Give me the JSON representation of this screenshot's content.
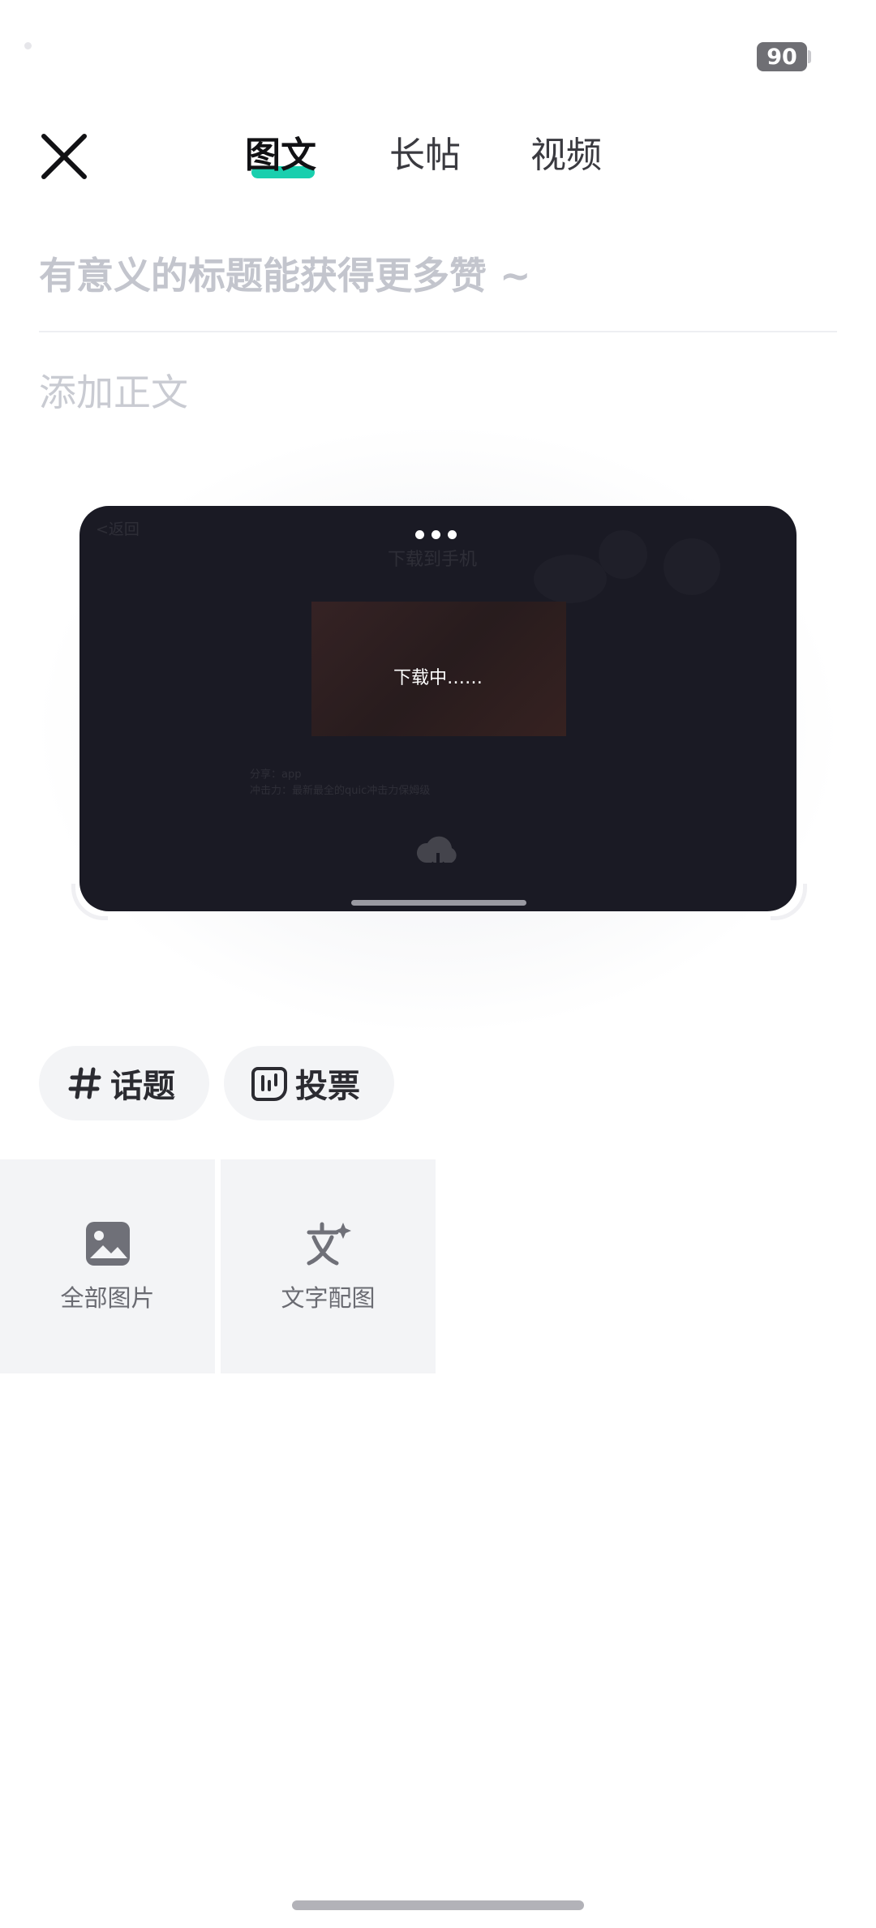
{
  "status_bar": {
    "battery": "90"
  },
  "header": {
    "tabs": [
      {
        "label": "图文",
        "active": true
      },
      {
        "label": "长帖",
        "active": false
      },
      {
        "label": "视频",
        "active": false
      }
    ],
    "accent_color": "#19cfae"
  },
  "editor": {
    "title_placeholder": "有意义的标题能获得更多赞 ~",
    "body_placeholder": "添加正文"
  },
  "video_preview": {
    "status_text": "下载中……",
    "background_texts": [
      "<返回",
      "下载到手机",
      "分享：app",
      "冲击力：最新最全的quic冲击力保姆级"
    ]
  },
  "chips": [
    {
      "icon": "hashtag-icon",
      "label": "话题"
    },
    {
      "icon": "poll-icon",
      "label": "投票"
    }
  ],
  "media_tiles": [
    {
      "icon": "image-icon",
      "label": "全部图片"
    },
    {
      "icon": "text-to-image-icon",
      "label": "文字配图"
    }
  ]
}
